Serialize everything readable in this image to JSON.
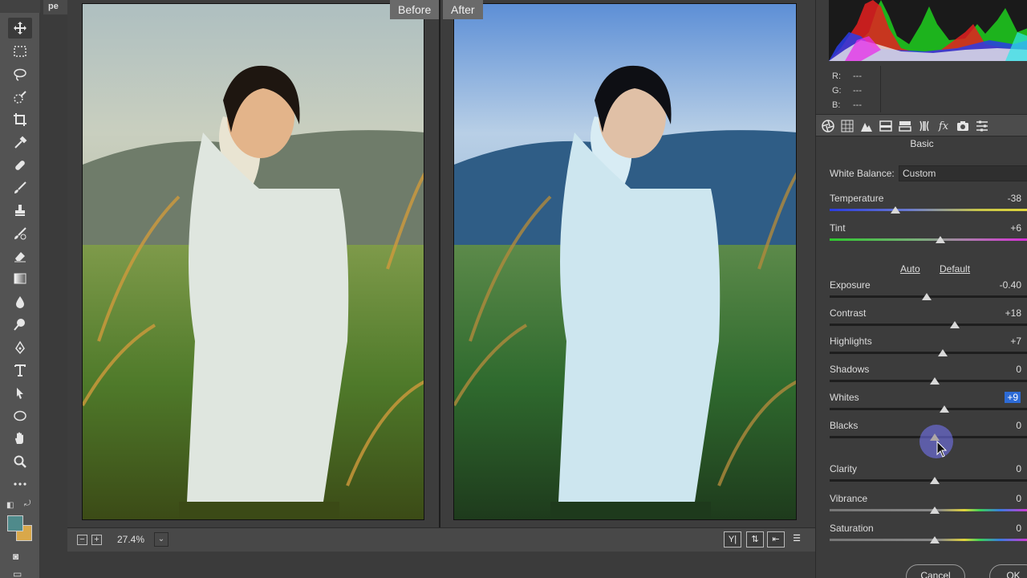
{
  "app": {
    "doc_tab": "pe"
  },
  "preview": {
    "before_label": "Before",
    "after_label": "After",
    "zoom": "27.4%",
    "zoom_out_label": "−",
    "zoom_in_label": "+"
  },
  "histogram": {
    "r_label": "R:",
    "g_label": "G:",
    "b_label": "B:",
    "r": "---",
    "g": "---",
    "b": "---"
  },
  "panel": {
    "section": "Basic",
    "white_balance_label": "White Balance:",
    "white_balance_value": "Custom",
    "auto_label": "Auto",
    "default_label": "Default",
    "sliders": [
      {
        "label": "Temperature",
        "value": "-38",
        "position": 0.33,
        "track": "temp"
      },
      {
        "label": "Tint",
        "value": "+6",
        "position": 0.56,
        "track": "tint"
      },
      {
        "label": "Exposure",
        "value": "-0.40",
        "position": 0.49,
        "track": "gray"
      },
      {
        "label": "Contrast",
        "value": "+18",
        "position": 0.63,
        "track": "gray"
      },
      {
        "label": "Highlights",
        "value": "+7",
        "position": 0.57,
        "track": "gray"
      },
      {
        "label": "Shadows",
        "value": "0",
        "position": 0.53,
        "track": "gray"
      },
      {
        "label": "Whites",
        "value": "+9",
        "position": 0.58,
        "track": "gray",
        "highlighted": true
      },
      {
        "label": "Blacks",
        "value": "0",
        "position": 0.53,
        "track": "gray",
        "active": true
      },
      {
        "label": "Clarity",
        "value": "0",
        "position": 0.53,
        "track": "gray"
      },
      {
        "label": "Vibrance",
        "value": "0",
        "position": 0.53,
        "track": "rainbow"
      },
      {
        "label": "Saturation",
        "value": "0",
        "position": 0.53,
        "track": "rainbow"
      }
    ]
  },
  "buttons": {
    "cancel": "Cancel",
    "ok": "OK"
  },
  "colors": {
    "foreground": "#4f8a8b",
    "background": "#d9a84a",
    "highlight": "#2d6bd6"
  }
}
